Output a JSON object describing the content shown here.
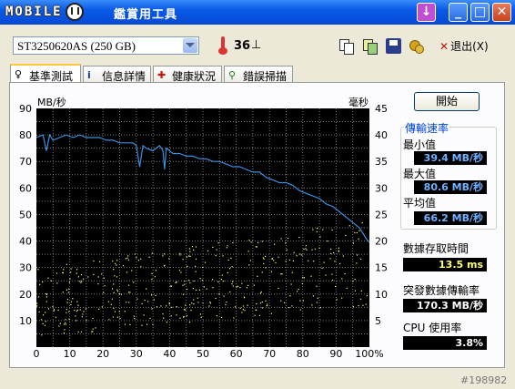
{
  "window": {
    "logo_text": "MOBILE",
    "title": "鑑賞用工具"
  },
  "toolbar": {
    "drive": "ST3250620AS (250 GB)",
    "temperature": "36",
    "temp_unit": "⊥",
    "exit_label": "退出(X)"
  },
  "tabs": [
    {
      "label": "基準測試",
      "icon": "benchmark-icon"
    },
    {
      "label": "信息詳情",
      "icon": "info-icon"
    },
    {
      "label": "健康狀況",
      "icon": "health-cross-icon"
    },
    {
      "label": "錯誤掃描",
      "icon": "magnifier-icon"
    }
  ],
  "panel": {
    "start_label": "開始",
    "rate_title": "傳輸速率",
    "min_label": "最小值",
    "min_value": "39.4 MB/秒",
    "max_label": "最大值",
    "max_value": "80.6 MB/秒",
    "avg_label": "平均值",
    "avg_value": "66.2 MB/秒",
    "access_label": "數據存取時間",
    "access_value": "13.5 ms",
    "burst_label": "突發數據傳輸率",
    "burst_value": "170.3 MB/秒",
    "cpu_label": "CPU 使用率",
    "cpu_value": "3.8%"
  },
  "watermark": "#198982",
  "colors": {
    "chart_bg": "#000000",
    "grid": "#7a7a7a",
    "transfer_line": "#3b8fe0",
    "access_dots": "#ffff78"
  },
  "chart_data": {
    "type": "line",
    "ylabel_left": "MB/秒",
    "ylabel_right": "毫秒",
    "x_ticks": [
      "0",
      "10",
      "20",
      "30",
      "40",
      "50",
      "60",
      "70",
      "80",
      "90",
      "100%"
    ],
    "y_left_ticks": [
      "90",
      "80",
      "70",
      "60",
      "50",
      "40",
      "30",
      "20",
      "10"
    ],
    "y_right_ticks": [
      "45",
      "40",
      "35",
      "30",
      "25",
      "20",
      "15",
      "10",
      "5"
    ],
    "xlim": [
      0,
      100
    ],
    "ylim_left": [
      0,
      90
    ],
    "ylim_right": [
      0,
      45
    ],
    "grid": true,
    "series": [
      {
        "name": "transfer rate",
        "axis": "left",
        "x": [
          0,
          2,
          3,
          4,
          5,
          7,
          9,
          11,
          13,
          15,
          17,
          19,
          21,
          23,
          25,
          27,
          29,
          30,
          31,
          32,
          33,
          35,
          37,
          38,
          38.5,
          39,
          41,
          43,
          45,
          47,
          49,
          51,
          53,
          55,
          57,
          59,
          61,
          63,
          65,
          67,
          69,
          71,
          73,
          75,
          77,
          79,
          81,
          83,
          85,
          87,
          89,
          91,
          93,
          95,
          97,
          98,
          99,
          100
        ],
        "y": [
          79,
          80,
          74,
          80,
          78,
          79,
          80,
          79,
          80,
          79,
          79,
          79,
          78,
          78,
          77,
          77,
          77,
          76,
          68,
          76,
          75,
          74,
          76,
          74,
          67,
          75,
          73,
          73,
          72,
          72,
          71,
          71,
          70,
          70,
          69,
          68,
          68,
          67,
          66,
          66,
          64,
          63,
          62,
          62,
          61,
          59,
          58,
          57,
          56,
          54,
          53,
          51,
          49,
          47,
          45,
          43,
          41,
          39.4
        ]
      },
      {
        "name": "access time",
        "axis": "right",
        "kind": "scatter",
        "x_range": [
          0,
          100
        ],
        "y_range_start": [
          2,
          15
        ],
        "y_range_end": [
          8,
          24
        ]
      }
    ]
  }
}
